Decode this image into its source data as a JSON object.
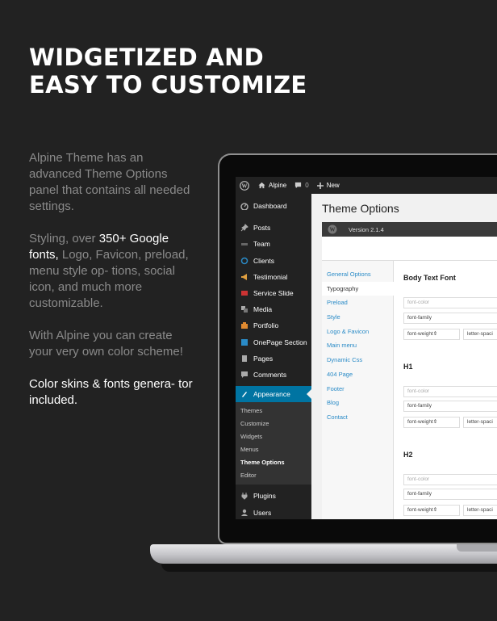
{
  "headline": {
    "line1": "WIDGETIZED AND",
    "line2": "EASY TO CUSTOMIZE"
  },
  "copy": {
    "p1": "Alpine Theme has an advanced Theme Options panel that contains all needed settings.",
    "p2_pre": "Styling, over ",
    "p2_hl": "350+ Google fonts,",
    "p2_post": " Logo, Favicon, preload, menu style op- tions, social icon, and much more customizable.",
    "p3": "With Alpine you can create your very own color scheme!",
    "p4": "Color skins & fonts genera- tor included."
  },
  "adminbar": {
    "site": "Alpine",
    "comments": "0",
    "new": "New"
  },
  "sidebar": {
    "items": [
      {
        "label": "Dashboard",
        "icon": "dashboard-icon"
      },
      {
        "label": "Posts",
        "icon": "pin-icon"
      },
      {
        "label": "Team",
        "icon": "team-icon"
      },
      {
        "label": "Clients",
        "icon": "clients-icon"
      },
      {
        "label": "Testimonial",
        "icon": "megaphone-icon"
      },
      {
        "label": "Service Slide",
        "icon": "slide-icon"
      },
      {
        "label": "Media",
        "icon": "media-icon"
      },
      {
        "label": "Portfolio",
        "icon": "portfolio-icon"
      },
      {
        "label": "OnePage Section",
        "icon": "section-icon"
      },
      {
        "label": "Pages",
        "icon": "pages-icon"
      },
      {
        "label": "Comments",
        "icon": "comments-icon"
      }
    ],
    "active": {
      "label": "Appearance",
      "icon": "appearance-icon"
    },
    "submenu": [
      "Themes",
      "Customize",
      "Widgets",
      "Menus",
      "Theme Options",
      "Editor"
    ],
    "after": [
      {
        "label": "Plugins",
        "icon": "plugins-icon"
      },
      {
        "label": "Users",
        "icon": "users-icon"
      }
    ]
  },
  "content": {
    "title": "Theme Options",
    "version": "Version 2.1.4",
    "tabs": [
      "General Options",
      "Typography",
      "Preload",
      "Style",
      "Logo & Favicon",
      "Main menu",
      "Dynamic Css",
      "404 Page",
      "Footer",
      "Blog",
      "Contact"
    ],
    "active_tab": "Typography",
    "sections": [
      {
        "title": "Body Text Font",
        "color_ph": "font-color",
        "family": "font-family",
        "weight": "font-weight",
        "spacing": "letter-spaci"
      },
      {
        "title": "H1",
        "color_ph": "font-color",
        "family": "font-family",
        "weight": "font-weight",
        "spacing": "letter-spaci"
      },
      {
        "title": "H2",
        "color_ph": "font-color",
        "family": "font-family",
        "weight": "font-weight",
        "spacing": "letter-spaci"
      }
    ]
  },
  "colors": {
    "background": "#222222",
    "accent": "#0074a2",
    "link": "#2a8bc7",
    "muted_text": "#8a8a8a"
  }
}
